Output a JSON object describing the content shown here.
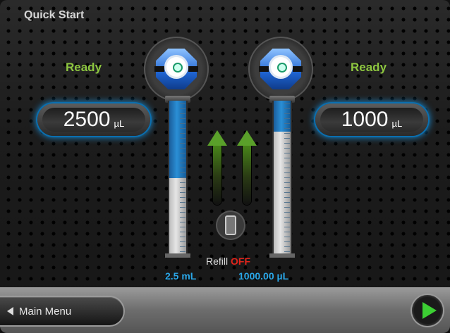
{
  "title": "Quick Start",
  "left_pump": {
    "status": "Ready",
    "volume_value": "2500",
    "volume_unit": "µL",
    "readout": "2.5 mL",
    "fill_fraction": 0.5
  },
  "right_pump": {
    "status": "Ready",
    "volume_value": "1000",
    "volume_unit": "µL",
    "readout": "1000.00 µL",
    "fill_fraction": 0.2
  },
  "refill": {
    "label": "Refill",
    "state": "OFF"
  },
  "footer": {
    "main_menu_label": "Main Menu"
  },
  "colors": {
    "accent_blue": "#1b8fd8",
    "ready_green": "#8dc63f",
    "off_red": "#e0241b",
    "play_green": "#3ccf33"
  },
  "icons": [
    "valve-icon",
    "up-arrow-icon",
    "refill-icon",
    "back-arrow-icon",
    "play-icon"
  ]
}
